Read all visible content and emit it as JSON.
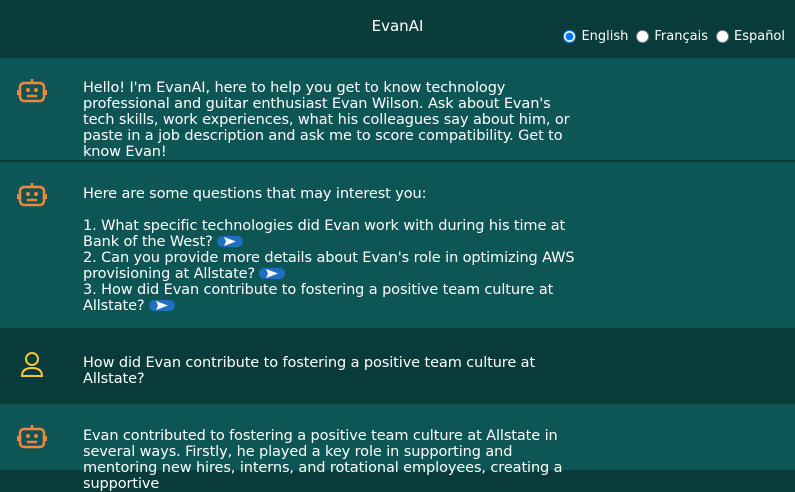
{
  "header": {
    "title": "EvanAI",
    "languages": [
      {
        "label": "English",
        "selected": true
      },
      {
        "label": "Français",
        "selected": false
      },
      {
        "label": "Español",
        "selected": false
      }
    ]
  },
  "messages": [
    {
      "role": "bot",
      "avatar_icon": "robot-icon",
      "text": "Hello! I'm EvanAI, here to help you get to know technology professional and guitar enthusiast Evan Wilson. Ask about Evan's tech skills, work experiences, what his colleagues say about him, or paste in a job description and ask me to score compatibility. Get to know Evan!"
    },
    {
      "role": "bot",
      "avatar_icon": "robot-icon",
      "intro": "Here are some questions that may interest you:",
      "questions": [
        "1. What specific technologies did Evan work with during his time at Bank of the West?",
        "2. Can you provide more details about Evan's role in optimizing AWS provisioning at Allstate?",
        "3. How did Evan contribute to fostering a positive team culture at Allstate?"
      ]
    },
    {
      "role": "user",
      "avatar_icon": "user-icon",
      "text": "How did Evan contribute to fostering a positive team culture at Allstate?"
    },
    {
      "role": "bot",
      "avatar_icon": "robot-icon",
      "text": "Evan contributed to fostering a positive team culture at Allstate in several ways. Firstly, he played a key role in supporting and mentoring new hires, interns, and rotational employees, creating a supportive"
    }
  ],
  "colors": {
    "background": "#0a3b3b",
    "bot_row": "#0e5555",
    "accent_orange": "#f0883e",
    "user_icon": "#f5c542",
    "send_button": "#1e6fbf"
  }
}
